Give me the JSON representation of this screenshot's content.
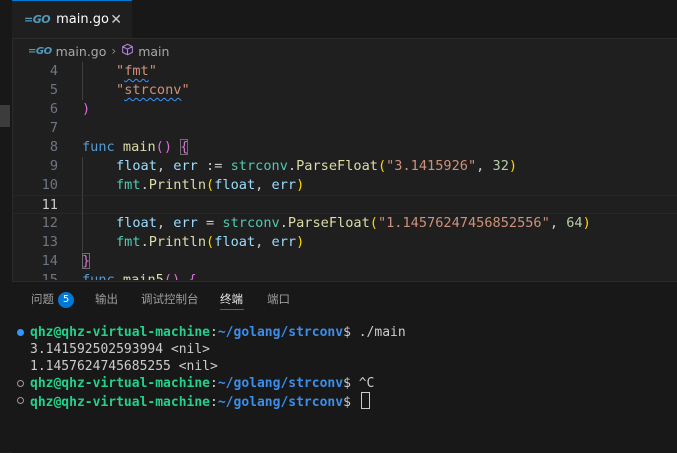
{
  "tab": {
    "icon": "go-icon",
    "label": "main.go",
    "close": "✕"
  },
  "breadcrumb": {
    "file": "main.go",
    "symbol": "main"
  },
  "editor": {
    "current_line": "11",
    "lines": [
      {
        "num": "4",
        "tokens": [
          {
            "t": "\"",
            "c": "str"
          },
          {
            "t": "fmt",
            "c": "str squiggle"
          },
          {
            "t": "\"",
            "c": "str"
          }
        ]
      },
      {
        "num": "5",
        "tokens": [
          {
            "t": "\"",
            "c": "str"
          },
          {
            "t": "strconv",
            "c": "str squiggle"
          },
          {
            "t": "\"",
            "c": "str"
          }
        ]
      },
      {
        "num": "6",
        "tokens": [
          {
            "t": ")",
            "c": "br2"
          }
        ]
      },
      {
        "num": "7",
        "tokens": []
      },
      {
        "num": "8",
        "tokens": [
          {
            "t": "func ",
            "c": "kw"
          },
          {
            "t": "main",
            "c": "fn"
          },
          {
            "t": "() ",
            "c": "br2"
          },
          {
            "t": "{",
            "c": "br2 bracket-box"
          }
        ]
      },
      {
        "num": "9",
        "tokens": [
          {
            "t": "float",
            "c": "var"
          },
          {
            "t": ", ",
            "c": "pl"
          },
          {
            "t": "err",
            "c": "var"
          },
          {
            "t": " := ",
            "c": "pl"
          },
          {
            "t": "strconv",
            "c": "pkg"
          },
          {
            "t": ".",
            "c": "pl"
          },
          {
            "t": "ParseFloat",
            "c": "fn"
          },
          {
            "t": "(",
            "c": "br1"
          },
          {
            "t": "\"3.1415926\"",
            "c": "str"
          },
          {
            "t": ", ",
            "c": "pl"
          },
          {
            "t": "32",
            "c": "num"
          },
          {
            "t": ")",
            "c": "br1"
          }
        ]
      },
      {
        "num": "10",
        "tokens": [
          {
            "t": "fmt",
            "c": "pkg"
          },
          {
            "t": ".",
            "c": "pl"
          },
          {
            "t": "Println",
            "c": "fn"
          },
          {
            "t": "(",
            "c": "br1"
          },
          {
            "t": "float",
            "c": "var"
          },
          {
            "t": ", ",
            "c": "pl"
          },
          {
            "t": "err",
            "c": "var"
          },
          {
            "t": ")",
            "c": "br1"
          }
        ]
      },
      {
        "num": "11",
        "tokens": []
      },
      {
        "num": "12",
        "tokens": [
          {
            "t": "float",
            "c": "var"
          },
          {
            "t": ", ",
            "c": "pl"
          },
          {
            "t": "err",
            "c": "var"
          },
          {
            "t": " = ",
            "c": "pl"
          },
          {
            "t": "strconv",
            "c": "pkg"
          },
          {
            "t": ".",
            "c": "pl"
          },
          {
            "t": "ParseFloat",
            "c": "fn"
          },
          {
            "t": "(",
            "c": "br1"
          },
          {
            "t": "\"1.14576247456852556\"",
            "c": "str"
          },
          {
            "t": ", ",
            "c": "pl"
          },
          {
            "t": "64",
            "c": "num"
          },
          {
            "t": ")",
            "c": "br1"
          }
        ]
      },
      {
        "num": "13",
        "tokens": [
          {
            "t": "fmt",
            "c": "pkg"
          },
          {
            "t": ".",
            "c": "pl"
          },
          {
            "t": "Println",
            "c": "fn"
          },
          {
            "t": "(",
            "c": "br1"
          },
          {
            "t": "float",
            "c": "var"
          },
          {
            "t": ", ",
            "c": "pl"
          },
          {
            "t": "err",
            "c": "var"
          },
          {
            "t": ")",
            "c": "br1"
          }
        ]
      },
      {
        "num": "14",
        "tokens": [
          {
            "t": "}",
            "c": "br2 bracket-box"
          }
        ]
      },
      {
        "num": "15",
        "tokens": [
          {
            "t": "func ",
            "c": "kw"
          },
          {
            "t": "main5",
            "c": "fn"
          },
          {
            "t": "() ",
            "c": "br2"
          },
          {
            "t": "{",
            "c": "br2"
          }
        ]
      }
    ]
  },
  "panel": {
    "tabs": {
      "problems": "问题",
      "problems_count": "5",
      "output": "输出",
      "debug_console": "调试控制台",
      "terminal": "终端",
      "ports": "端口"
    },
    "terminal": {
      "prompt_user": "qhz@qhz-virtual-machine",
      "prompt_colon": ":",
      "prompt_path": "~/golang/strconv",
      "prompt_end": "$ ",
      "lines": [
        {
          "type": "prompt",
          "marker": "blue",
          "cmd": "./main"
        },
        {
          "type": "output",
          "text": "3.141592502593994 <nil>"
        },
        {
          "type": "output",
          "text": "1.1457624745685255 <nil>"
        },
        {
          "type": "prompt",
          "marker": "hollow",
          "cmd": "^C"
        },
        {
          "type": "prompt",
          "marker": "hollow",
          "cmd": "",
          "cursor": true
        }
      ]
    }
  }
}
